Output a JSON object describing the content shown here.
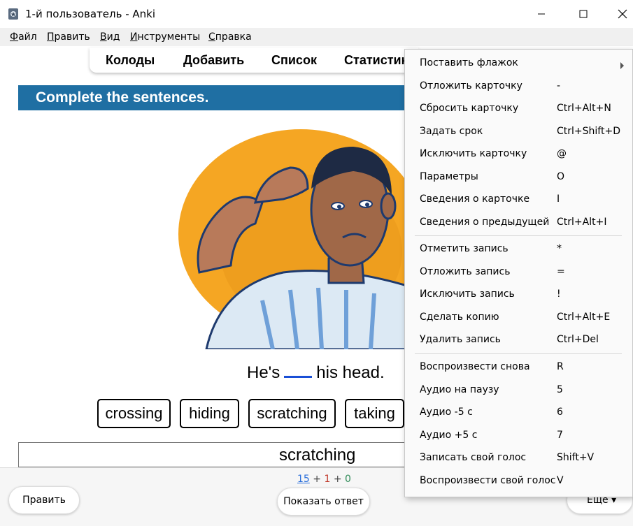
{
  "window": {
    "title": "1-й пользователь - Anki"
  },
  "menubar": {
    "items": [
      {
        "label": "Файл",
        "key": "Ф",
        "rest": "айл"
      },
      {
        "label": "Править",
        "key": "П",
        "rest": "равить"
      },
      {
        "label": "Вид",
        "key": "В",
        "rest": "ид"
      },
      {
        "label": "Инструменты",
        "key": "И",
        "rest": "нструменты"
      },
      {
        "label": "Справка",
        "key": "С",
        "rest": "правка"
      }
    ]
  },
  "toolbar": {
    "decks": "Колоды",
    "add": "Добавить",
    "browse": "Список",
    "stats": "Статистик"
  },
  "card": {
    "heading": "Complete the sentences.",
    "sentence_before": "He's",
    "sentence_after": "his head.",
    "choices": [
      "crossing",
      "hiding",
      "scratching",
      "taking"
    ],
    "answer": "scratching"
  },
  "bottom": {
    "count_new": "15",
    "count_learn": "1",
    "count_review": "0",
    "plus": "+",
    "edit_label": "Править",
    "show_answer_label": "Показать ответ",
    "more_label": "Еще ▾"
  },
  "context_menu": {
    "items": [
      {
        "label": "Поставить флажок",
        "shortcut": "",
        "submenu": true
      },
      {
        "label": "Отложить карточку",
        "shortcut": "-"
      },
      {
        "label": "Сбросить карточку",
        "shortcut": "Ctrl+Alt+N"
      },
      {
        "label": "Задать срок",
        "shortcut": "Ctrl+Shift+D"
      },
      {
        "label": "Исключить карточку",
        "shortcut": "@"
      },
      {
        "label": "Параметры",
        "shortcut": "O"
      },
      {
        "label": "Сведения о карточке",
        "shortcut": "I"
      },
      {
        "label": "Сведения о предыдущей",
        "shortcut": "Ctrl+Alt+I"
      },
      {
        "label": "Отметить запись",
        "shortcut": "*"
      },
      {
        "label": "Отложить запись",
        "shortcut": "="
      },
      {
        "label": "Исключить запись",
        "shortcut": "!"
      },
      {
        "label": "Сделать копию",
        "shortcut": "Ctrl+Alt+E"
      },
      {
        "label": "Удалить запись",
        "shortcut": "Ctrl+Del"
      },
      {
        "label": "Воспроизвести снова",
        "shortcut": "R"
      },
      {
        "label": "Аудио на паузу",
        "shortcut": "5"
      },
      {
        "label": "Аудио -5 с",
        "shortcut": "6"
      },
      {
        "label": "Аудио +5 с",
        "shortcut": "7"
      },
      {
        "label": "Записать свой голос",
        "shortcut": "Shift+V"
      },
      {
        "label": "Воспроизвести свой голос",
        "shortcut": "V"
      }
    ]
  },
  "colors": {
    "banner": "#1f6fa3",
    "blank_line": "#1a4fd6",
    "illustration_bg": "#f5a623"
  }
}
